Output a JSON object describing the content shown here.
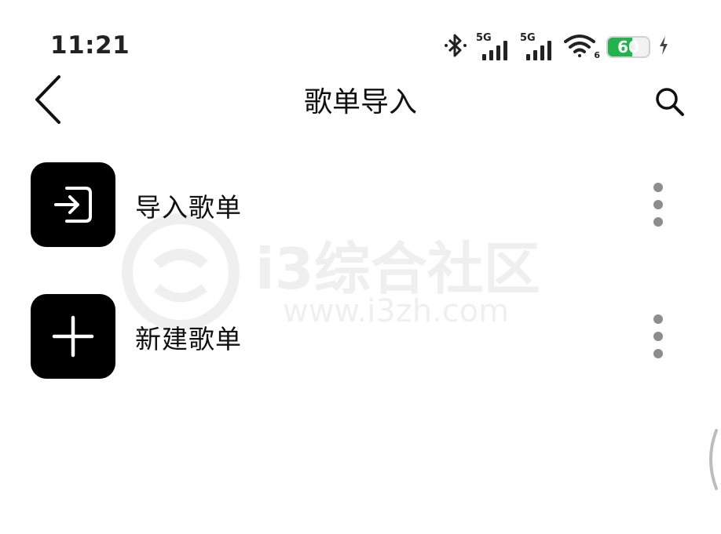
{
  "status_bar": {
    "time": "11:21",
    "network_1": "5G",
    "network_2": "5G",
    "wifi_badge": "6",
    "battery_percent": "60",
    "battery_level": 0.6,
    "battery_color": "#23b24b"
  },
  "header": {
    "title": "歌单导入"
  },
  "list": {
    "items": [
      {
        "label": "导入歌单",
        "icon": "import-icon"
      },
      {
        "label": "新建歌单",
        "icon": "plus-icon"
      }
    ]
  },
  "watermark": {
    "text": "i3综合社区",
    "url": "www.i3zh.com"
  }
}
